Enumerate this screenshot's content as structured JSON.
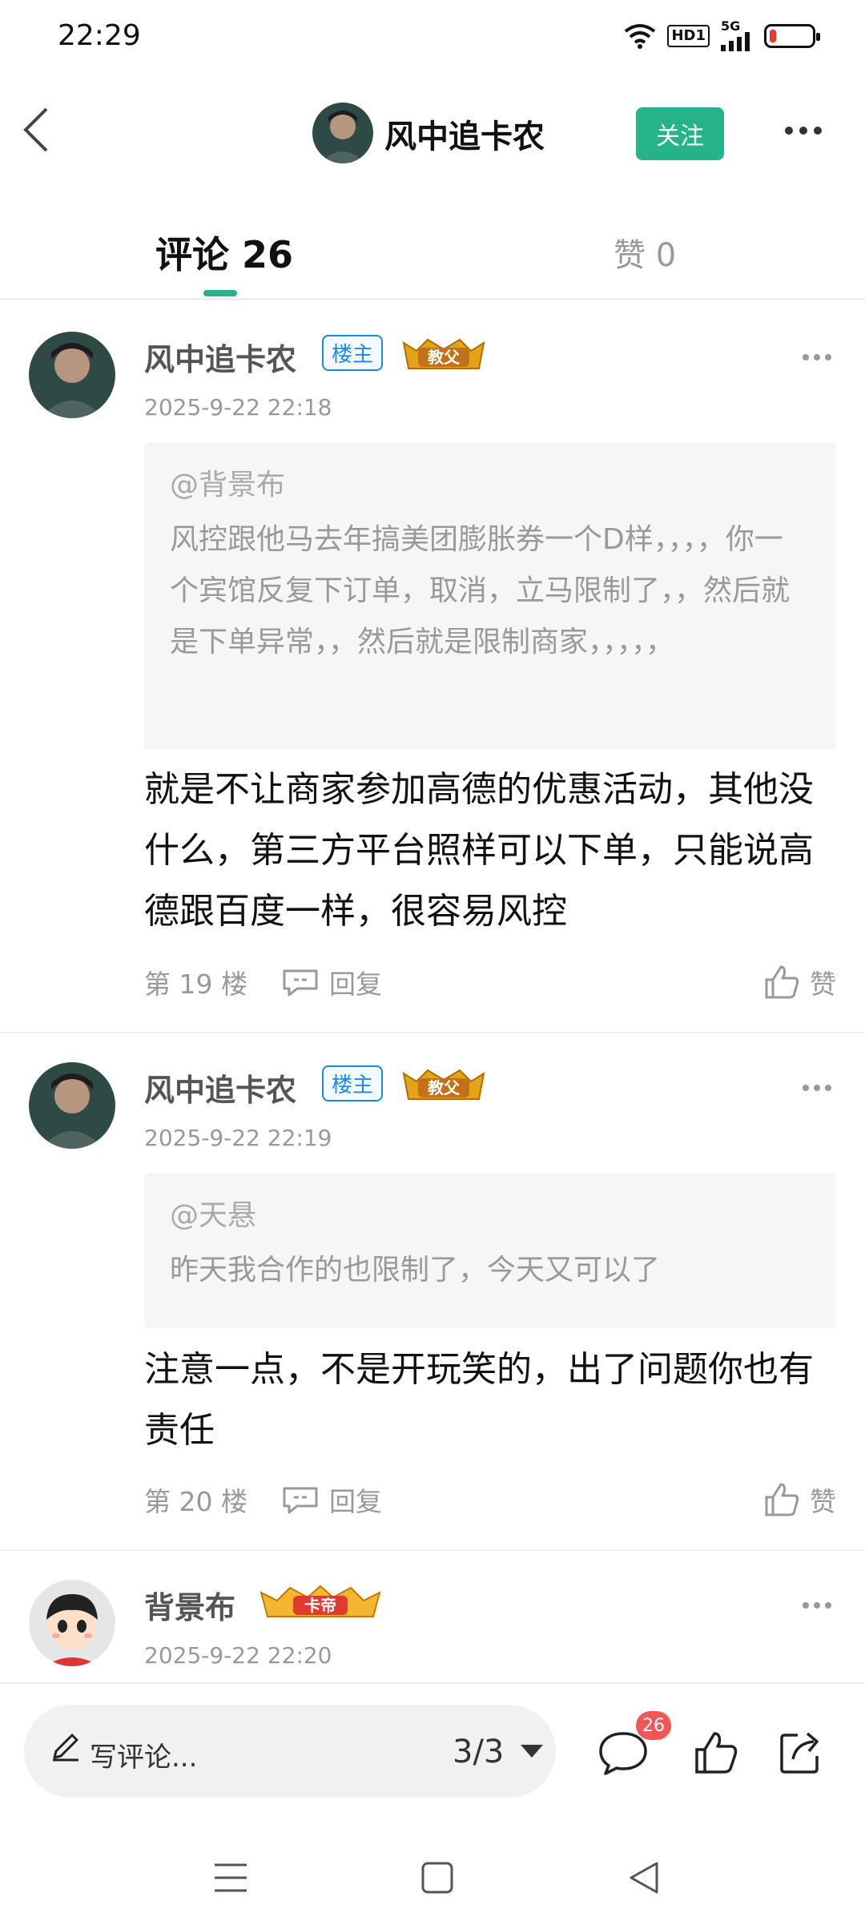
{
  "status_bar": {
    "time": "22:29",
    "hd_label": "HD1",
    "network_label": "5G",
    "battery_level": 0.15
  },
  "header": {
    "back_icon": "chevron-left-icon",
    "author_name": "风中追卡农",
    "follow_label": "关注",
    "more_icon": "more-dots-icon"
  },
  "tabs": [
    {
      "label": "评论 26",
      "active": true
    },
    {
      "label": "赞 0",
      "active": false
    }
  ],
  "comments": [
    {
      "name": "风中追卡农",
      "op_badge": "楼主",
      "rank_badge": "教父",
      "time": "2025-9-22 22:18",
      "quote_at": "@背景布",
      "quote_text": "风控跟他马去年搞美团膨胀券一个D样，，，，你一个宾馆反复下订单，取消，立马限制了，，然后就是下单异常，，然后就是限制商家，，，，，",
      "body": "就是不让商家参加高德的优惠活动，其他没什么，第三方平台照样可以下单，只能说高德跟百度一样，很容易风控",
      "floor": "第 19 楼",
      "reply_label": "回复",
      "like_label": "赞"
    },
    {
      "name": "风中追卡农",
      "op_badge": "楼主",
      "rank_badge": "教父",
      "time": "2025-9-22 22:19",
      "quote_at": "@天悬",
      "quote_text": "昨天我合作的也限制了，今天又可以了",
      "body": "注意一点，不是开玩笑的，出了问题你也有责任",
      "floor": "第 20 楼",
      "reply_label": "回复",
      "like_label": "赞"
    },
    {
      "name": "背景布",
      "rank_badge": "卡帝",
      "time": "2025-9-22 22:20"
    }
  ],
  "bottom_bar": {
    "write_placeholder": "写评论...",
    "page_indicator": "3/3",
    "comment_count": "26"
  },
  "colors": {
    "accent": "#26b38a",
    "op_badge": "#1e88e5",
    "count_badge": "#f25757",
    "battery_low": "#e53935"
  }
}
